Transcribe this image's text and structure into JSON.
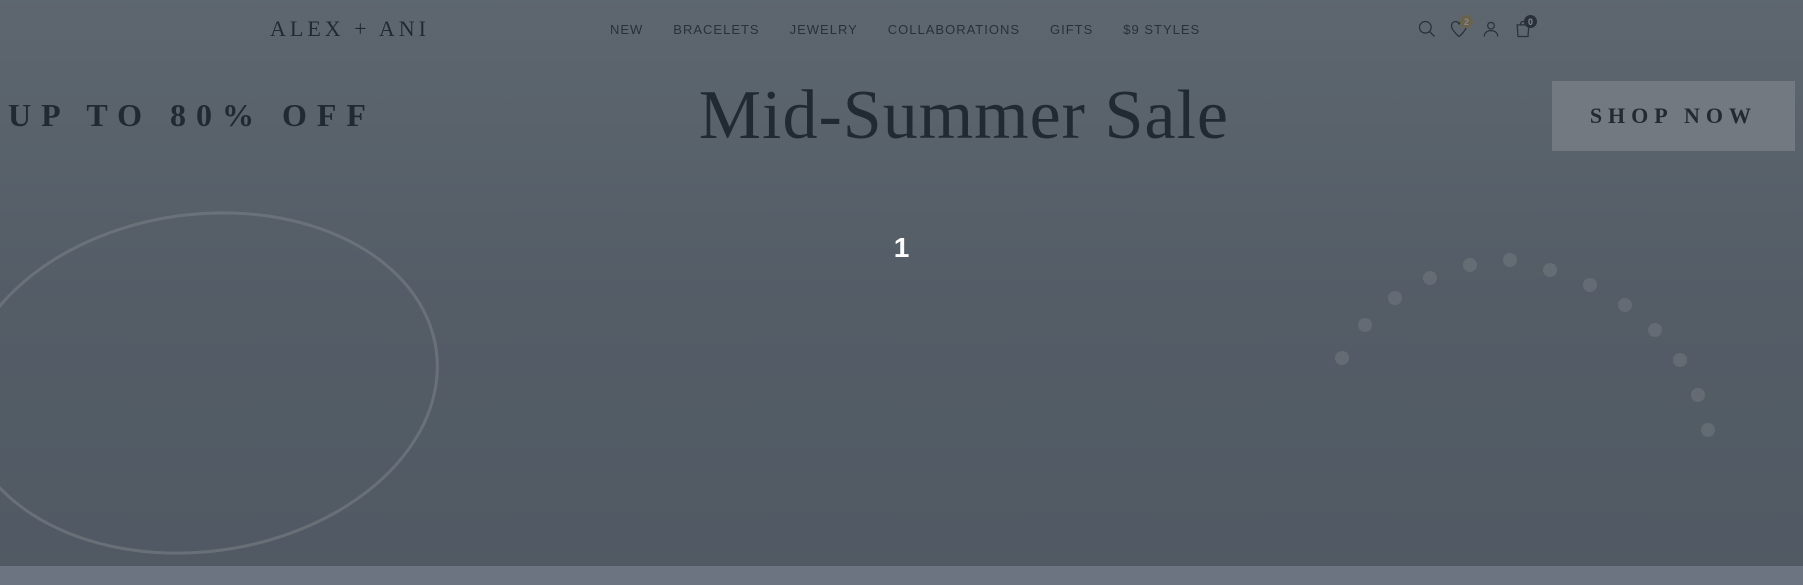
{
  "header": {
    "logo": "ALEX + ANI",
    "nav": [
      {
        "label": "NEW"
      },
      {
        "label": "BRACELETS"
      },
      {
        "label": "JEWELRY"
      },
      {
        "label": "COLLABORATIONS"
      },
      {
        "label": "GIFTS"
      },
      {
        "label": "$9 STYLES"
      }
    ],
    "wishlist_count": "2",
    "cart_count": "0"
  },
  "hero": {
    "promo_left": "UP TO 80% OFF",
    "promo_center": "Mid-Summer Sale",
    "cta_label": "SHOP NOW"
  },
  "overlay": {
    "number": "1"
  }
}
